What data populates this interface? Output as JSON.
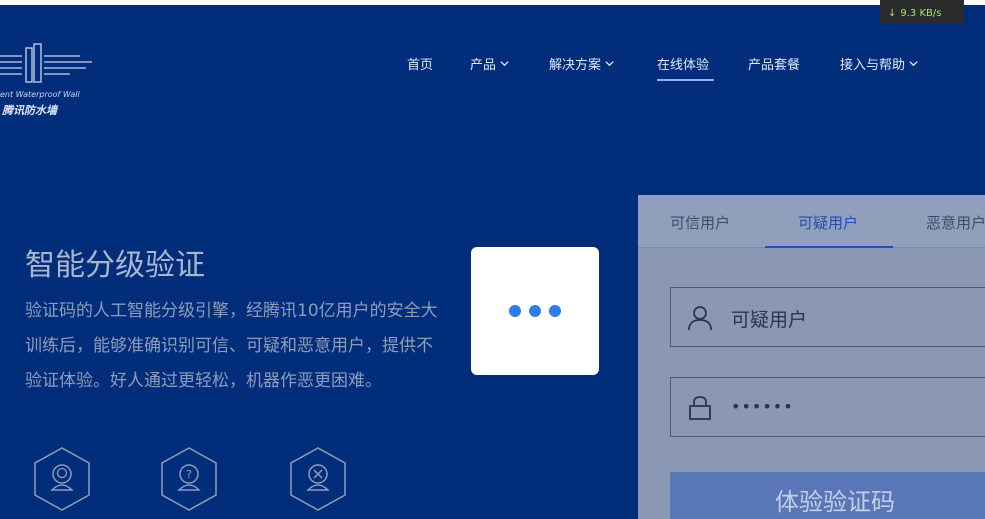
{
  "status_bar": {
    "net_speed": "9.3 KB/s",
    "arrow": "↓"
  },
  "logo": {
    "icon": "tencent-wall-logo-icon",
    "english": "ent Waterproof Wall",
    "chinese": "腾讯防水墙"
  },
  "nav": {
    "items": [
      {
        "label": "首页",
        "dropdown": false
      },
      {
        "label": "产品",
        "dropdown": true
      },
      {
        "label": "解决方案",
        "dropdown": true
      },
      {
        "label": "在线体验",
        "dropdown": false,
        "active": true
      },
      {
        "label": "产品套餐",
        "dropdown": false
      },
      {
        "label": "接入与帮助",
        "dropdown": true
      }
    ]
  },
  "hero": {
    "title": "智能分级验证",
    "lines": [
      "验证码的人工智能分级引擎，经腾讯10亿用户的安全大",
      "训练后，能够准确识别可信、可疑和恶意用户，提供不",
      "验证体验。好人通过更轻松，机器作恶更困难。"
    ]
  },
  "features": [
    {
      "icon": "trusted-user-hex-icon"
    },
    {
      "icon": "suspicious-user-hex-icon"
    },
    {
      "icon": "malicious-user-hex-icon"
    }
  ],
  "demo_panel": {
    "tabs": [
      {
        "label": "可信用户",
        "active": false
      },
      {
        "label": "可疑用户",
        "active": true
      },
      {
        "label": "恶意用户",
        "active": false
      }
    ],
    "username": "可疑用户",
    "password": "••••••",
    "submit_label": "体验验证码"
  },
  "loading_overlay": {
    "icon": "loading-dots-icon"
  },
  "colors": {
    "background": "#022d7b",
    "accent": "#2f7de8",
    "active_tab": "#1e4fae"
  }
}
